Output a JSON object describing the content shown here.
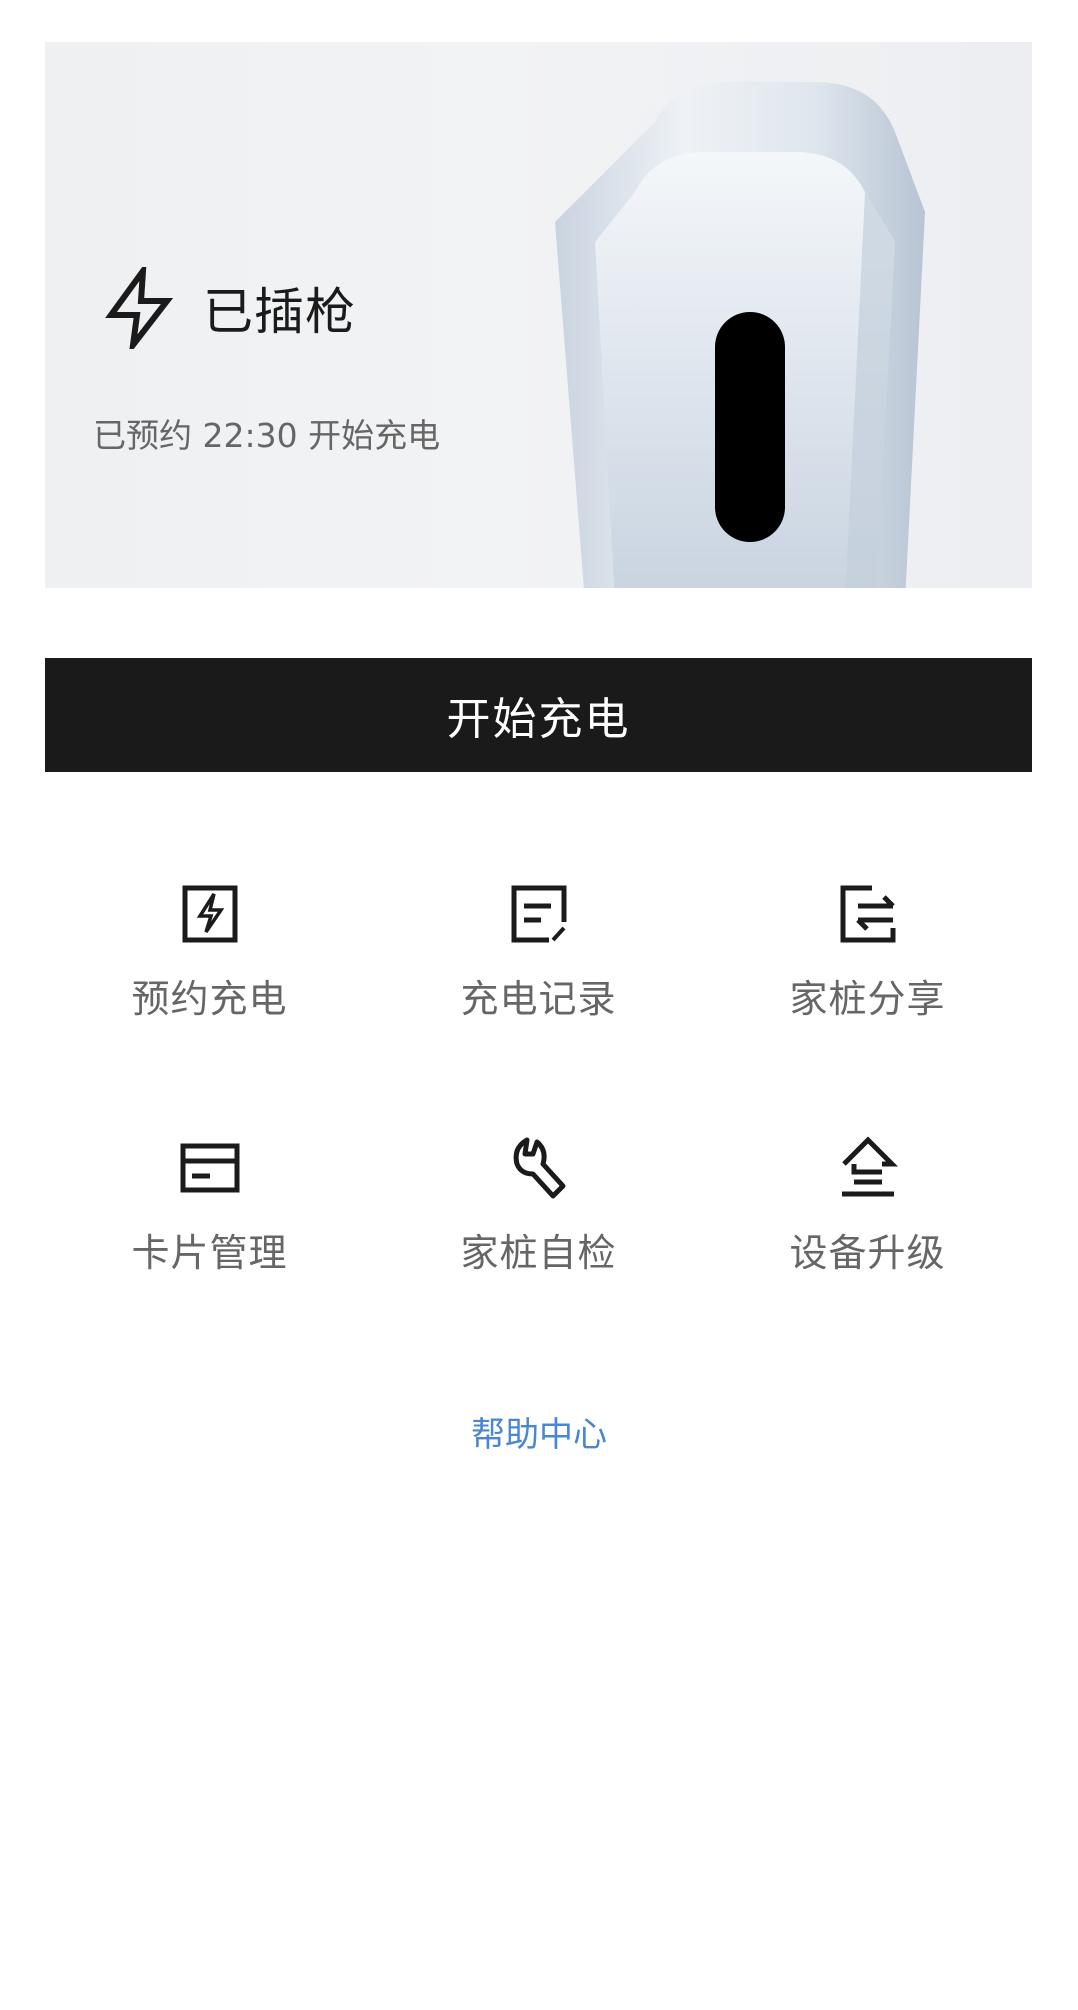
{
  "hero": {
    "status": "已插枪",
    "schedule": "已预约 22:30 开始充电"
  },
  "actions": {
    "start_label": "开始充电"
  },
  "grid": [
    [
      {
        "label": "预约充电",
        "icon": "schedule-charge-icon"
      },
      {
        "label": "充电记录",
        "icon": "charge-record-icon"
      },
      {
        "label": "家桩分享",
        "icon": "share-icon"
      }
    ],
    [
      {
        "label": "卡片管理",
        "icon": "card-icon"
      },
      {
        "label": "家桩自检",
        "icon": "wrench-icon"
      },
      {
        "label": "设备升级",
        "icon": "upgrade-icon"
      }
    ]
  ],
  "footer": {
    "help_label": "帮助中心"
  },
  "colors": {
    "primary_button": "#1a1a1a",
    "link": "#4a86d4",
    "label": "#666666"
  }
}
